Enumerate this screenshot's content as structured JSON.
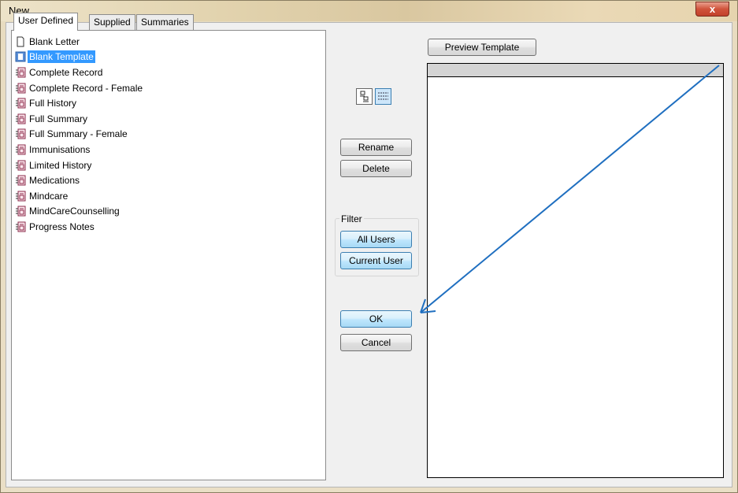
{
  "window": {
    "title": "New",
    "close_glyph": "x"
  },
  "tabs": [
    {
      "label": "User Defined",
      "active": true
    },
    {
      "label": "Supplied",
      "active": false
    },
    {
      "label": "Summaries",
      "active": false
    }
  ],
  "templates": [
    {
      "label": "Blank Letter",
      "icon": "blank-document-icon",
      "selected": false
    },
    {
      "label": "Blank Template",
      "icon": "template-icon",
      "selected": true
    },
    {
      "label": "Complete Record",
      "icon": "template-icon",
      "selected": false
    },
    {
      "label": "Complete Record - Female",
      "icon": "template-icon",
      "selected": false
    },
    {
      "label": "Full History",
      "icon": "template-icon",
      "selected": false
    },
    {
      "label": "Full Summary",
      "icon": "template-icon",
      "selected": false
    },
    {
      "label": "Full Summary - Female",
      "icon": "template-icon",
      "selected": false
    },
    {
      "label": "Immunisations",
      "icon": "template-icon",
      "selected": false
    },
    {
      "label": "Limited History",
      "icon": "template-icon",
      "selected": false
    },
    {
      "label": "Medications",
      "icon": "template-icon",
      "selected": false
    },
    {
      "label": "Mindcare",
      "icon": "template-icon",
      "selected": false
    },
    {
      "label": "MindCareCounselling",
      "icon": "template-icon",
      "selected": false
    },
    {
      "label": "Progress Notes",
      "icon": "template-icon",
      "selected": false
    }
  ],
  "view_icons": [
    "large-icons-view-icon",
    "list-view-icon"
  ],
  "buttons": {
    "rename": "Rename",
    "delete": "Delete",
    "ok": "OK",
    "cancel": "Cancel",
    "preview_template": "Preview Template"
  },
  "filter": {
    "label": "Filter",
    "all_users": "All Users",
    "current_user": "Current User"
  },
  "annotation": {
    "type": "arrow",
    "color": "#1f6fc0"
  }
}
